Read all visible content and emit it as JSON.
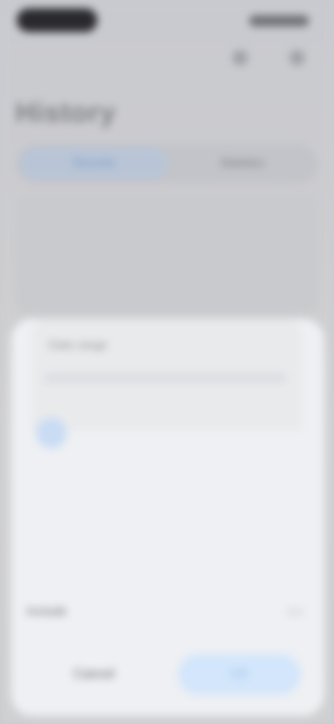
{
  "status_bar": {
    "time": "",
    "icons": [
      "signal-icon",
      "wifi-icon",
      "battery-icon"
    ]
  },
  "header": {
    "title": "History",
    "icons": [
      "search-icon",
      "more-icon"
    ]
  },
  "tabs": [
    {
      "label": "Records"
    },
    {
      "label": "Statistics"
    }
  ],
  "sheet": {
    "field_label": "Date range",
    "calendar": {
      "rows": [
        [
          "",
          "",
          "",
          "",
          "",
          "",
          ""
        ],
        [
          "",
          "",
          "",
          "",
          "",
          "",
          ""
        ],
        [
          "",
          "",
          "",
          "",
          "",
          "",
          ""
        ],
        [
          "",
          "",
          "",
          "",
          "",
          "",
          ""
        ]
      ]
    },
    "option": {
      "label": "Include",
      "value": ""
    },
    "cancel_label": "Cancel",
    "confirm_label": "OK"
  },
  "colors": {
    "accent": "#6a8fc2",
    "background": "#cacbd0",
    "sheet": "#eef0f3"
  }
}
